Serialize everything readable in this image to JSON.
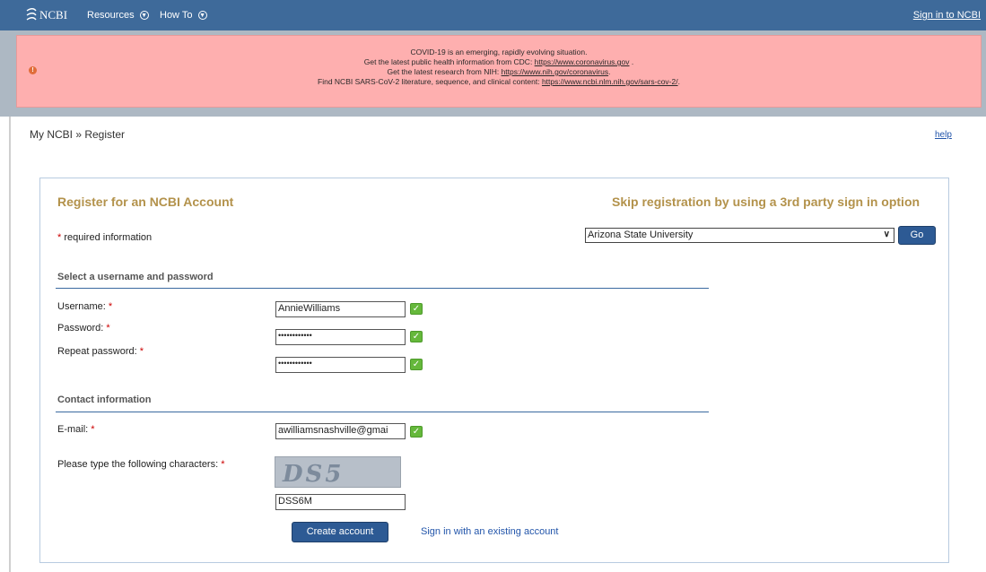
{
  "topbar": {
    "logo": "NCBI",
    "resources": "Resources",
    "howto": "How To",
    "signin": "Sign in to NCBI"
  },
  "banner": {
    "line1": "COVID-19 is an emerging, rapidly evolving situation.",
    "line2_prefix": "Get the latest public health information from CDC: ",
    "line2_link": "https://www.coronavirus.gov",
    "line2_suffix": " .",
    "line3_prefix": "Get the latest research from NIH: ",
    "line3_link": "https://www.nih.gov/coronavirus",
    "line3_suffix": ".",
    "line4_prefix": "Find NCBI SARS-CoV-2 literature, sequence, and clinical content: ",
    "line4_link": "https://www.ncbi.nlm.nih.gov/sars-cov-2/",
    "line4_suffix": ".",
    "icon": "!"
  },
  "breadcrumb": "My NCBI » Register",
  "help": "help",
  "panel": {
    "title": "Register for an NCBI Account",
    "skip_title": "Skip registration by using a 3rd party sign in option",
    "required_star": "*",
    "required_text": " required information",
    "institution": "Arizona State University",
    "go_button": "Go",
    "section_credentials": "Select a username and password",
    "username_label": "Username: ",
    "password_label": "Password: ",
    "repeat_label": "Repeat password: ",
    "star": "*",
    "username_value": "AnnieWilliams",
    "password_value": "••••••••••••",
    "repeat_value": "••••••••••••",
    "section_contact": "Contact information",
    "email_label": "E-mail: ",
    "email_value": "awilliamsnashville@gmai",
    "captcha_label": "Please type the following characters: ",
    "captcha_image_text": "DS5 6M",
    "captcha_value": "DSS6M",
    "create_button": "Create account",
    "existing_link": "Sign in with an existing account",
    "check": "✓"
  }
}
